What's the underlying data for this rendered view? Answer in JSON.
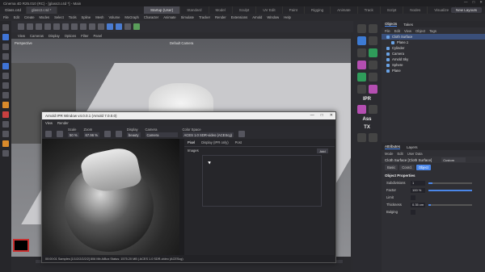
{
  "app": {
    "title": "Cinema 4D R25.010 (RC) - [glass3.c4d *] - Main",
    "window_controls": [
      "—",
      "□",
      "✕"
    ]
  },
  "doc_tabs": [
    "Glass.c4d",
    "glass3.c4d *"
  ],
  "layouts": [
    "Startup (User)",
    "Standard",
    "Model",
    "Sculpt",
    "UV Edit",
    "Paint",
    "Rigging",
    "Animate",
    "Track",
    "Script",
    "Nodes",
    "Visualize"
  ],
  "new_layouts_label": "New Layouts",
  "menubar": [
    "File",
    "Edit",
    "Create",
    "Modes",
    "Select",
    "Tools",
    "Spline",
    "Mesh",
    "Volume",
    "MoGraph",
    "Character",
    "Animate",
    "Simulate",
    "Tracker",
    "Render",
    "Extensions",
    "Arnold",
    "Window",
    "Help"
  ],
  "viewport": {
    "menu": [
      "View",
      "Cameras",
      "Display",
      "Options",
      "Filter",
      "Panel"
    ],
    "label_left": "Perspective",
    "label_center": "Default Camera"
  },
  "objects_panel": {
    "tabs": [
      "Objects",
      "Takes"
    ],
    "menu": [
      "File",
      "Edit",
      "View",
      "Object",
      "Tags"
    ],
    "items": [
      {
        "name": "Cloth Surface",
        "selected": true
      },
      {
        "name": "Plane.1",
        "selected": false
      },
      {
        "name": "Cylinder",
        "selected": false
      },
      {
        "name": "Camera",
        "selected": false
      },
      {
        "name": "Arnold Sky",
        "selected": false
      },
      {
        "name": "Sphere",
        "selected": false
      },
      {
        "name": "Plane",
        "selected": false
      }
    ]
  },
  "attributes_panel": {
    "tabs": [
      "Attributes",
      "Layers"
    ],
    "menu": [
      "Mode",
      "Edit",
      "User Data"
    ],
    "title": "Cloth Surface [Cloth Surface]",
    "dropdown": "Custom",
    "subtabs": [
      "Basic",
      "Coord.",
      "Object"
    ],
    "active_subtab": "Object",
    "section": "Object Properties",
    "rows": [
      {
        "label": "Subdivisions",
        "value": "1",
        "fill": 0.1
      },
      {
        "label": "Factor",
        "value": "100 %",
        "fill": 1.0
      },
      {
        "label": "Limit",
        "value": "",
        "fill": 0
      },
      {
        "label": "Thickness",
        "value": "0.35 cm",
        "fill": 0.05
      },
      {
        "label": "Bulging",
        "value": "",
        "fill": 0
      }
    ]
  },
  "right_icons": [
    "IPR",
    "Ass",
    "TX"
  ],
  "ipr": {
    "title": "Arnold IPR Window v4.0.0.1 (Arnold 7.0.0.0)",
    "menu": [
      "View",
      "Render"
    ],
    "scale_label": "Scale",
    "scale_value": "50 %",
    "zoom_label": "Zoom",
    "zoom_value": "67.96 %",
    "display_label": "Display",
    "display_value": "beauty",
    "camera_label": "Camera",
    "camera_value": "Camera",
    "color_space_label": "Color Space",
    "color_space_value": "ACES 1.0 SDR-video (ACEScg)",
    "right_tabs": [
      "Pixel",
      "Display (IPR only)",
      "Post"
    ],
    "images_label": "Images",
    "add_label": "Add",
    "status": "00:00:01 Samples [1/1/2/2/2/2/2] 806 Mb AiBox Status: 1575.20 MB | ACES 1.0 SDR-video (ACEScg)"
  },
  "colors": {
    "accent_blue": "#4a86e8",
    "arnold_pink": "#b44eb1",
    "arnold_green": "#2f9c5a",
    "active_layout": "#4a4a52"
  }
}
